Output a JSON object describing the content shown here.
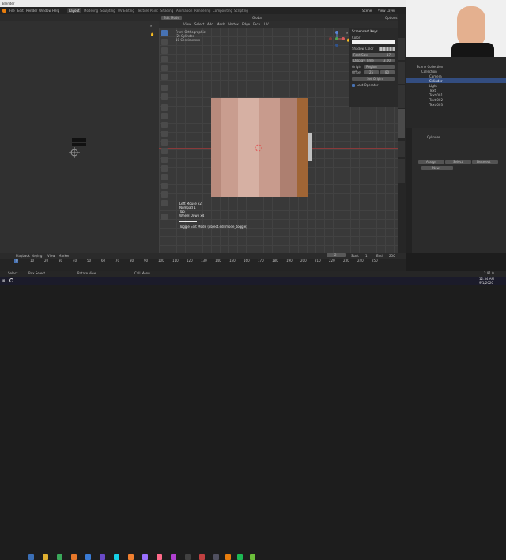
{
  "window": {
    "title": "Blender"
  },
  "menu": [
    "File",
    "Edit",
    "Render",
    "Window",
    "Help"
  ],
  "workspaces": [
    "Layout",
    "Modeling",
    "Sculpting",
    "UV Editing",
    "Texture Paint",
    "Shading",
    "Animation",
    "Rendering",
    "Compositing",
    "Scripting"
  ],
  "window_right": {
    "scene": "Scene",
    "view_layer": "View Layer"
  },
  "header": {
    "mode": "Edit Mode",
    "menus": [
      "View",
      "Select",
      "Add",
      "Mesh",
      "Vertex",
      "Edge",
      "Face",
      "UV"
    ],
    "transform": "Global",
    "options": "Options"
  },
  "overlay": {
    "lines": [
      "Front Orthographic",
      "(2) Cylinder",
      "10 Centimeters"
    ]
  },
  "screencast": {
    "lines": [
      "Left Mouse x2",
      "Numpad 1",
      "Tab",
      "Wheel Down x4"
    ],
    "last": "Toggle Edit Mode (object.editmode_toggle)"
  },
  "npanel": {
    "title": "Screencast Keys",
    "color_label": "Color",
    "shadow_label": "Shadow Color",
    "font_size_label": "Font Size",
    "font_size": "17",
    "display_time_label": "Display Time",
    "display_time": "3.00",
    "origin_label": "Origin",
    "origin": "Region",
    "offset_label": "Offset",
    "offset_x": "25",
    "offset_y": "80",
    "set_origin": "Set Origin",
    "last_operator": "Last Operator",
    "tabs": [
      "Item",
      "Tool",
      "View",
      "Screencast Keys",
      "Edit",
      "Screencast Pro"
    ]
  },
  "outliner": {
    "title": "Scene Collection",
    "items": [
      {
        "label": "Collection"
      },
      {
        "label": "Camera"
      },
      {
        "label": "Cylinder"
      },
      {
        "label": "Light"
      },
      {
        "label": "Text"
      },
      {
        "label": "Text.001"
      },
      {
        "label": "Text.002"
      },
      {
        "label": "Text.003"
      }
    ]
  },
  "properties": {
    "object": "Cylinder",
    "buttons": [
      "Assign",
      "Select",
      "Deselect"
    ],
    "new": "New"
  },
  "timeline": {
    "menus": [
      "Playback",
      "Keying",
      "View",
      "Marker"
    ],
    "frame": "2",
    "start_label": "Start",
    "start": "1",
    "end_label": "End",
    "end": "250",
    "ticks": [
      "0",
      "10",
      "20",
      "30",
      "40",
      "50",
      "60",
      "70",
      "80",
      "90",
      "100",
      "110",
      "120",
      "130",
      "140",
      "150",
      "160",
      "170",
      "180",
      "190",
      "200",
      "210",
      "220",
      "230",
      "240",
      "250"
    ]
  },
  "status": {
    "items": [
      "Select",
      "Box Select",
      "Rotate View",
      "Call Menu"
    ],
    "version": "2.91.0"
  },
  "taskbar": {
    "time": "12:34 AM",
    "date": "9/1/2020"
  }
}
